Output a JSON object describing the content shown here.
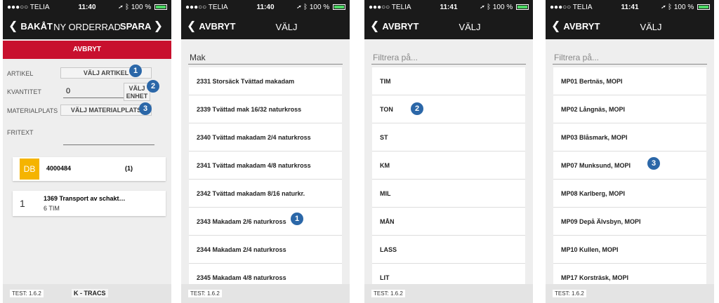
{
  "status": {
    "carrier": "●●●○○ TELIA",
    "battery": "100 %"
  },
  "screen1": {
    "time": "11:40",
    "nav": {
      "back": "BAKÅT",
      "title": "NY ORDERRAD",
      "save": "SPARA"
    },
    "cancel": "AVBRYT",
    "form": {
      "artikel_label": "ARTIKEL",
      "artikel_btn": "VÄLJ ARTIKEL",
      "kvantitet_label": "KVANTITET",
      "kvantitet_value": "0",
      "enhet_btn_1": "VÄLJ",
      "enhet_btn_2": "ENHET",
      "materialplats_label": "MATERIALPLATS",
      "materialplats_btn": "VÄLJ MATERIALPLATS",
      "fritext_label": "FRITEXT"
    },
    "card1": {
      "badge": "DB",
      "number": "4000484",
      "count": "(1)"
    },
    "card2": {
      "index": "1",
      "title": "1369 Transport av schakt…",
      "sub": "6 TIM"
    },
    "footer": {
      "test": "TEST: 1.6.2",
      "app": "K - TRACS"
    }
  },
  "screen2": {
    "time": "11:40",
    "nav": {
      "back": "AVBRYT",
      "title": "VÄLJ"
    },
    "search_value": "Mak",
    "items": [
      "2331 Storsäck Tvättad makadam",
      "2339 Tvättad mak 16/32 naturkross",
      "2340 Tvättad makadam 2/4 naturkross",
      "2341 Tvättad makadam 4/8 naturkross",
      "2342 Tvättad makadam 8/16 naturkr.",
      "2343 Makadam 2/6 naturkross",
      "2344 Makadam 2/4 naturkross",
      "2345 Makadam 4/8 naturkross"
    ],
    "footer": {
      "test": "TEST: 1.6.2"
    }
  },
  "screen3": {
    "time": "11:41",
    "nav": {
      "back": "AVBRYT",
      "title": "VÄLJ"
    },
    "search_placeholder": "Filtrera på...",
    "items": [
      "TIM",
      "TON",
      "ST",
      "KM",
      "MIL",
      "MÅN",
      "LASS",
      "LIT"
    ],
    "footer": {
      "test": "TEST: 1.6.2"
    }
  },
  "screen4": {
    "time": "11:41",
    "nav": {
      "back": "AVBRYT",
      "title": "VÄLJ"
    },
    "search_placeholder": "Filtrera på...",
    "items": [
      "MP01 Bertnäs, MOPI",
      "MP02 Långnäs, MOPI",
      "MP03 Blåsmark, MOPI",
      "MP07 Munksund, MOPI",
      "MP08 Karlberg, MOPI",
      "MP09 Depå Älvsbyn, MOPI",
      "MP10 Kullen, MOPI",
      "MP17 Korsträsk, MOPI"
    ],
    "footer": {
      "test": "TEST: 1.6.2"
    }
  },
  "callouts": {
    "one": "1",
    "two": "2",
    "three": "3"
  },
  "colors": {
    "accent_red": "#c8102e",
    "callout_blue": "#2b67a8",
    "db_yellow": "#f5b400",
    "bar_dark": "#1a1a1a"
  },
  "icons": [
    "wifi-icon",
    "location-icon",
    "bluetooth-icon",
    "battery-icon",
    "chevron-left-icon",
    "chevron-right-icon"
  ]
}
